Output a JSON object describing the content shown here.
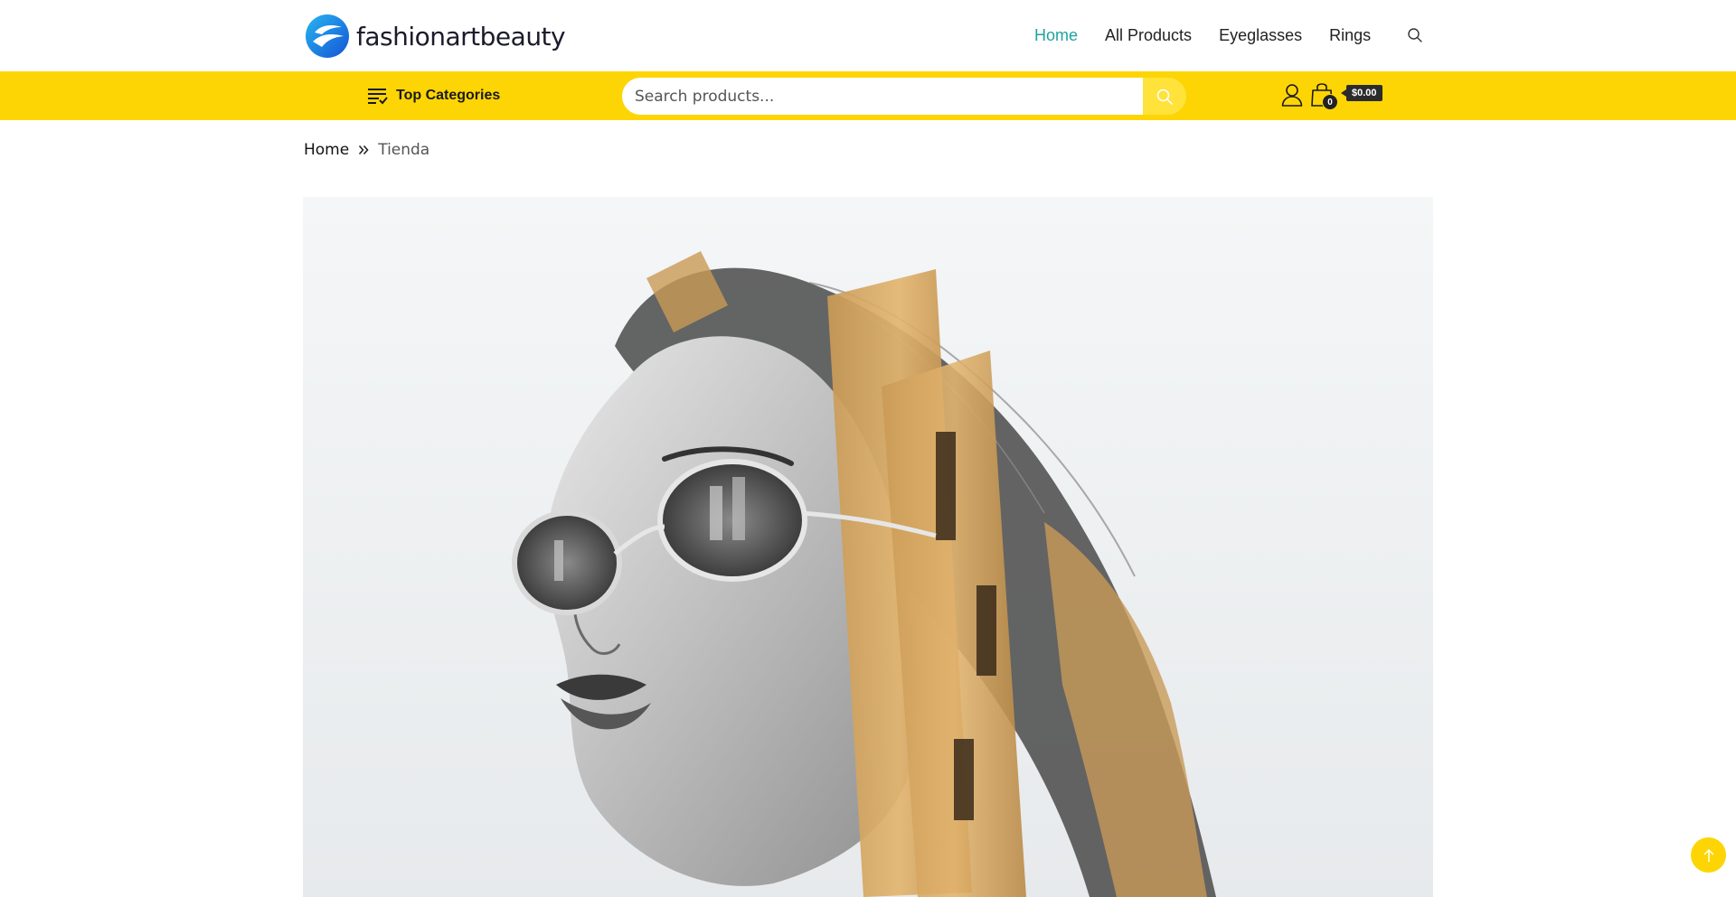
{
  "brand": {
    "name": "fashionartbeauty",
    "logo_icon": "f-wave-logo",
    "accent": "#1fa3a0",
    "yellow": "#fdd504"
  },
  "nav": {
    "items": [
      {
        "label": "Home",
        "active": true
      },
      {
        "label": "All Products",
        "active": false
      },
      {
        "label": "Eyeglasses",
        "active": false
      },
      {
        "label": "Rings",
        "active": false
      }
    ],
    "search_icon": "search-icon"
  },
  "categories_bar": {
    "categories_label": "Top Categories",
    "search_placeholder": "Search products...",
    "cart_count": "0",
    "cart_total": "$0.00"
  },
  "breadcrumb": {
    "home": "Home",
    "current": "Tienda"
  }
}
